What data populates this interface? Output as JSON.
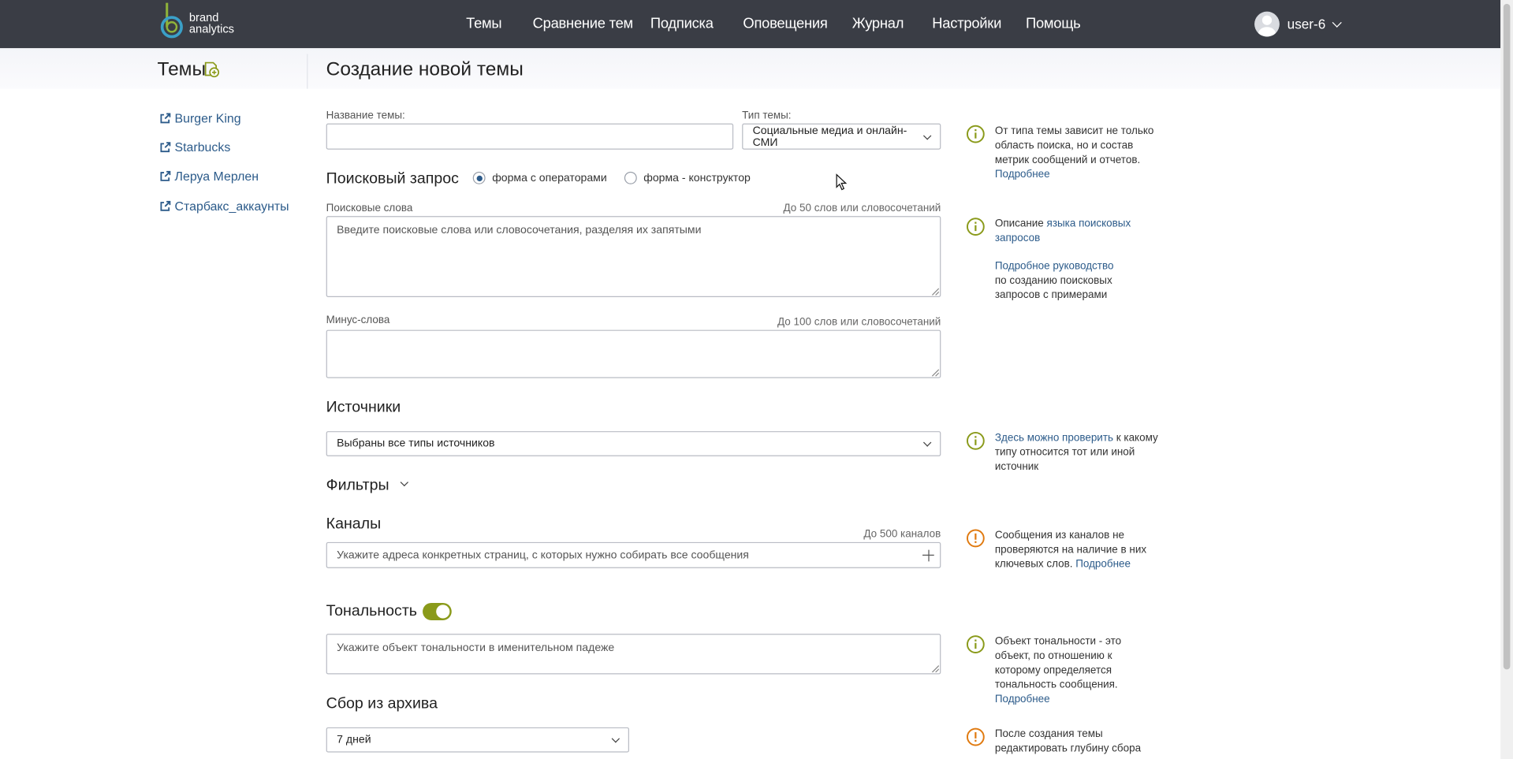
{
  "brand": {
    "line1": "brand",
    "line2": "analytics"
  },
  "nav": {
    "items": [
      "Темы",
      "Сравнение тем",
      "Подписка",
      "Оповещения",
      "Журнал",
      "Настройки",
      "Помощь"
    ]
  },
  "user": {
    "name": "user-6"
  },
  "sidebar": {
    "title": "Темы",
    "links": [
      "Burger King",
      "Starbucks",
      "Леруа Мерлен",
      "Старбакс_аккаунты"
    ]
  },
  "page": {
    "title": "Создание новой темы"
  },
  "form": {
    "topic_name_label": "Название темы:",
    "topic_name_value": "",
    "topic_type_label": "Тип темы:",
    "topic_type_value": "Социальные медиа и онлайн-СМИ",
    "search_section": "Поисковый запрос",
    "radio_operators": "форма с операторами",
    "radio_constructor": "форма - конструктор",
    "search_words_label": "Поисковые слова",
    "search_words_limit": "До 50 слов или словосочетаний",
    "search_words_placeholder": "Введите поисковые слова или словосочетания, разделяя их запятыми",
    "minus_words_label": "Минус-слова",
    "minus_words_limit": "До 100 слов или словосочетаний",
    "sources_section": "Источники",
    "sources_value": "Выбраны все типы источников",
    "filters_section": "Фильтры",
    "channels_section": "Каналы",
    "channels_limit": "До 500 каналов",
    "channels_placeholder": "Укажите адреса конкретных страниц, с которых нужно собирать все сообщения",
    "tone_section": "Тональность",
    "tone_enabled": true,
    "tone_placeholder": "Укажите объект тональности в именительном падеже",
    "archive_section": "Сбор из архива",
    "archive_value": "7 дней"
  },
  "hints": {
    "type": {
      "text": "От типа темы зависит не только область поиска, но и состав метрик сообщений и отчетов.",
      "link": "Подробнее"
    },
    "query": {
      "prefix": "Описание ",
      "link1": "языка поисковых запросов",
      "link2": "Подробное руководство",
      "suffix": "по созданию поисковых запросов с примерами"
    },
    "sources": {
      "link": "Здесь можно проверить",
      "text": " к какому типу относится тот или иной источник"
    },
    "channels": {
      "text": "Сообщения из каналов не проверяются на наличие в них ключевых слов. ",
      "link": "Подробнее"
    },
    "tone": {
      "text": "Объект тональности - это объект, по отношению к которому определяется тональность сообщения. ",
      "link": "Подробнее"
    },
    "archive": {
      "text": "После создания темы редактировать глубину сбора"
    }
  },
  "colors": {
    "topbar": "#3a3d45",
    "accent": "#8a9a1a",
    "link": "#2c5b8a",
    "warning": "#e07a10"
  }
}
